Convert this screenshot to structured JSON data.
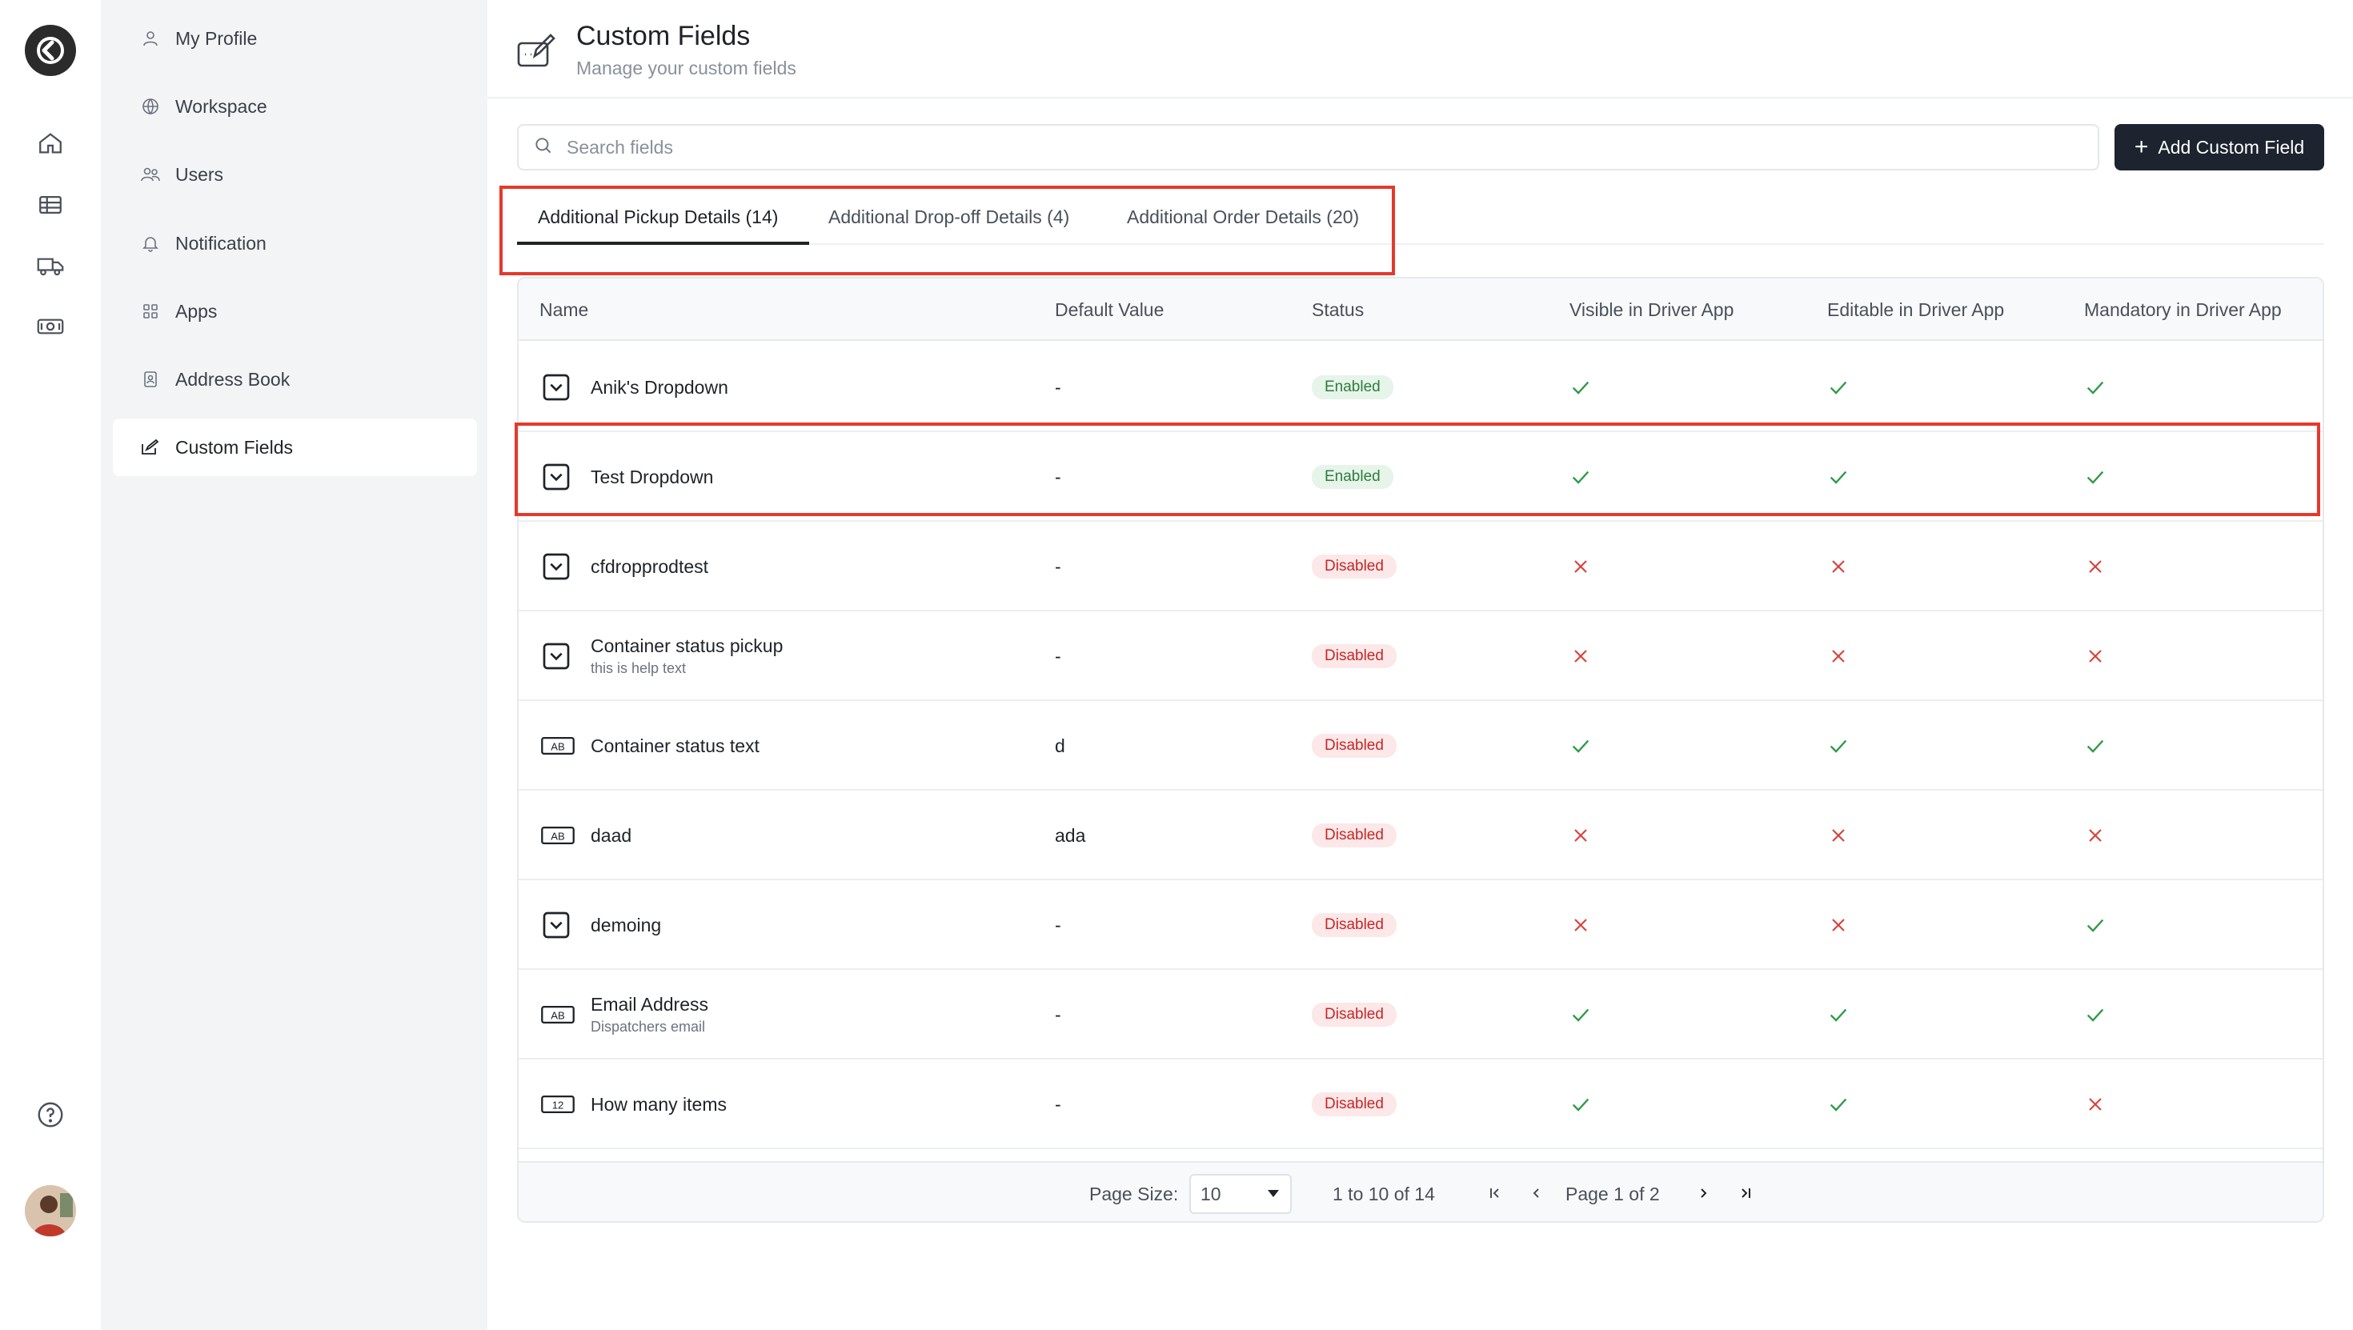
{
  "rail": {
    "icons": [
      "logo-icon",
      "home-icon",
      "table-icon",
      "truck-icon",
      "cash-icon",
      "help-icon",
      "avatar"
    ]
  },
  "sidebar": {
    "items": [
      {
        "label": "My Profile",
        "icon": "user-icon"
      },
      {
        "label": "Workspace",
        "icon": "globe-icon"
      },
      {
        "label": "Users",
        "icon": "users-icon"
      },
      {
        "label": "Notification",
        "icon": "bell-icon"
      },
      {
        "label": "Apps",
        "icon": "apps-icon"
      },
      {
        "label": "Address Book",
        "icon": "address-book-icon"
      },
      {
        "label": "Custom Fields",
        "icon": "edit-icon",
        "active": true
      }
    ]
  },
  "header": {
    "title": "Custom Fields",
    "subtitle": "Manage your custom fields"
  },
  "search": {
    "placeholder": "Search fields",
    "value": ""
  },
  "add_button": {
    "label": "Add Custom Field"
  },
  "tabs": [
    {
      "label": "Additional Pickup Details (14)",
      "active": true
    },
    {
      "label": "Additional Drop-off Details (4)",
      "active": false
    },
    {
      "label": "Additional Order Details (20)",
      "active": false
    }
  ],
  "table": {
    "columns": [
      "Name",
      "Default Value",
      "Status",
      "Visible in Driver App",
      "Editable in Driver App",
      "Mandatory in Driver App"
    ],
    "rows": [
      {
        "type": "dropdown",
        "name": "Anik's Dropdown",
        "help": "",
        "default": "-",
        "status": "Enabled",
        "visible": true,
        "editable": true,
        "mandatory": true
      },
      {
        "type": "dropdown",
        "name": "Test Dropdown",
        "help": "",
        "default": "-",
        "status": "Enabled",
        "visible": true,
        "editable": true,
        "mandatory": true
      },
      {
        "type": "dropdown",
        "name": "cfdropprodtest",
        "help": "",
        "default": "-",
        "status": "Disabled",
        "visible": false,
        "editable": false,
        "mandatory": false
      },
      {
        "type": "dropdown",
        "name": "Container status pickup",
        "help": "this is help text",
        "default": "-",
        "status": "Disabled",
        "visible": false,
        "editable": false,
        "mandatory": false
      },
      {
        "type": "text",
        "name": "Container status text",
        "help": "",
        "default": "d",
        "status": "Disabled",
        "visible": true,
        "editable": true,
        "mandatory": true
      },
      {
        "type": "text",
        "name": "daad",
        "help": "",
        "default": "ada",
        "status": "Disabled",
        "visible": false,
        "editable": false,
        "mandatory": false
      },
      {
        "type": "dropdown",
        "name": "demoing",
        "help": "",
        "default": "-",
        "status": "Disabled",
        "visible": false,
        "editable": false,
        "mandatory": true
      },
      {
        "type": "text",
        "name": "Email Address",
        "help": "Dispatchers email",
        "default": "-",
        "status": "Disabled",
        "visible": true,
        "editable": true,
        "mandatory": true
      },
      {
        "type": "number",
        "name": "How many items",
        "help": "",
        "default": "-",
        "status": "Disabled",
        "visible": true,
        "editable": true,
        "mandatory": false
      }
    ],
    "type_icon_text": {
      "text": "AB",
      "number": "12"
    }
  },
  "pager": {
    "page_size_label": "Page Size:",
    "page_size_value": "10",
    "range": "1 to 10 of 14",
    "page": "Page 1 of 2"
  },
  "colors": {
    "highlight": "#e5392b",
    "check": "#2e9a47",
    "cross": "#d9403a",
    "primary_button": "#1d2430"
  }
}
